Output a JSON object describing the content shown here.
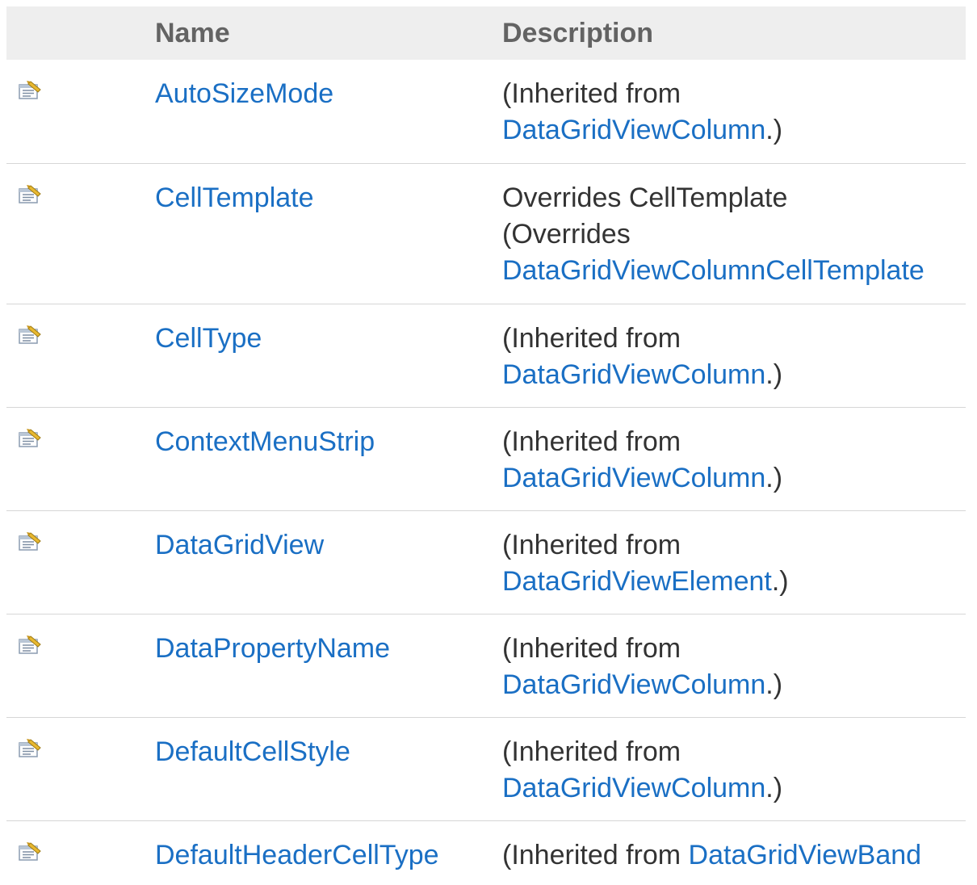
{
  "table": {
    "headers": {
      "name": "Name",
      "description": "Description"
    },
    "rows": [
      {
        "icon": "property-icon",
        "name": "AutoSizeMode",
        "desc_lines": [
          {
            "text": "(Inherited from"
          },
          {
            "link": "DataGridViewColumn",
            "suffix": ".)"
          }
        ]
      },
      {
        "icon": "property-icon",
        "name": "CellTemplate",
        "desc_lines": [
          {
            "text": "Overrides CellTemplate"
          },
          {
            "text": "(Overrides"
          },
          {
            "link": "DataGridViewColumnCellTemplate",
            "suffix": ""
          }
        ]
      },
      {
        "icon": "property-icon",
        "name": "CellType",
        "desc_lines": [
          {
            "text": "(Inherited from"
          },
          {
            "link": "DataGridViewColumn",
            "suffix": ".)"
          }
        ]
      },
      {
        "icon": "property-icon",
        "name": "ContextMenuStrip",
        "desc_lines": [
          {
            "text": "(Inherited from"
          },
          {
            "link": "DataGridViewColumn",
            "suffix": ".)"
          }
        ]
      },
      {
        "icon": "property-icon",
        "name": "DataGridView",
        "desc_lines": [
          {
            "text": "(Inherited from"
          },
          {
            "link": "DataGridViewElement",
            "suffix": ".)"
          }
        ]
      },
      {
        "icon": "property-icon",
        "name": "DataPropertyName",
        "desc_lines": [
          {
            "text": "(Inherited from"
          },
          {
            "link": "DataGridViewColumn",
            "suffix": ".)"
          }
        ]
      },
      {
        "icon": "property-icon",
        "name": "DefaultCellStyle",
        "desc_lines": [
          {
            "text": "(Inherited from"
          },
          {
            "link": "DataGridViewColumn",
            "suffix": ".)"
          }
        ]
      },
      {
        "icon": "property-icon",
        "name": "DefaultHeaderCellType",
        "desc_lines": [
          {
            "prefix": "(Inherited from ",
            "link": "DataGridViewBand",
            "suffix": ""
          }
        ]
      }
    ]
  },
  "colors": {
    "link": "#1a6fc4",
    "text": "#333333",
    "header_bg": "#eeeeee",
    "header_text": "#636363",
    "row_border": "#d6d6d6"
  }
}
